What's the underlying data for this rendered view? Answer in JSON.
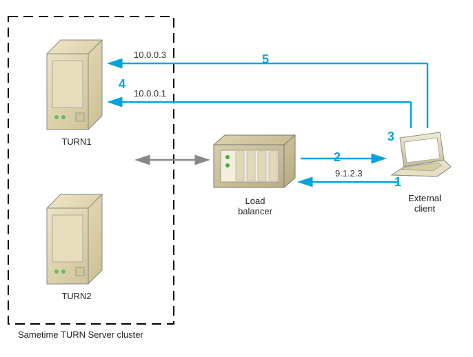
{
  "cluster": {
    "caption": "Sametime TURN Server cluster"
  },
  "servers": {
    "turn1": "TURN1",
    "turn2": "TURN2"
  },
  "loadbalancer": {
    "label_line1": "Load",
    "label_line2": "balancer"
  },
  "client": {
    "label_line1": "External",
    "label_line2": "client"
  },
  "flows": {
    "ip1": "10.0.0.3",
    "ip2": "10.0.0.1",
    "ip3": "9.1.2.3",
    "step1": "1",
    "step2": "2",
    "step3": "3",
    "step4": "4",
    "step5": "5"
  }
}
